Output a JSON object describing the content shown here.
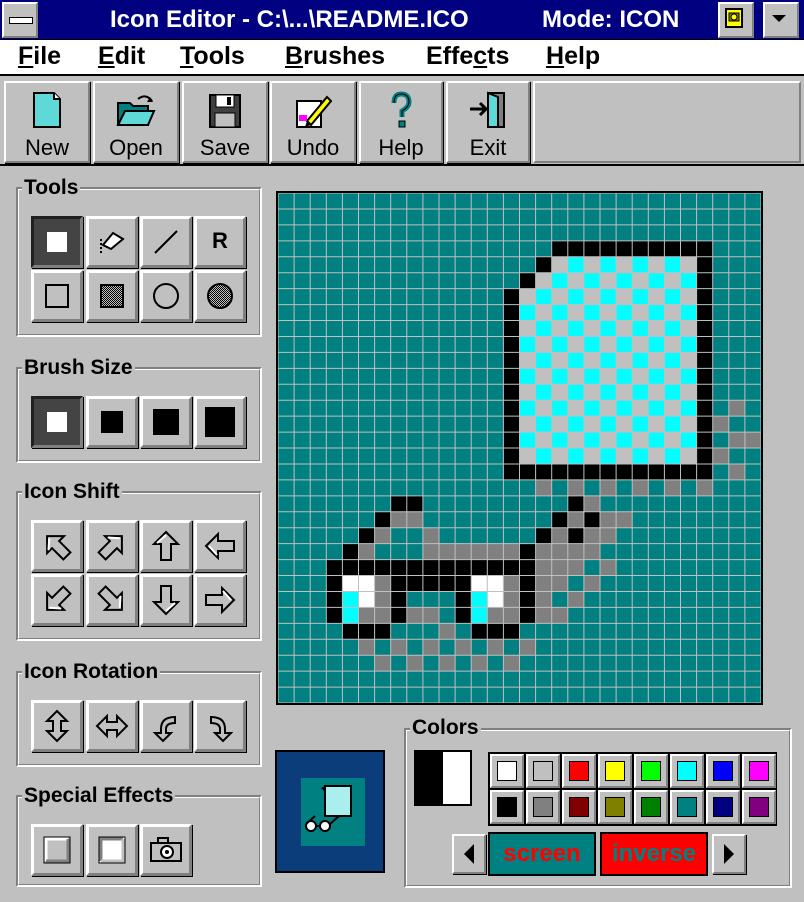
{
  "window": {
    "title": "Icon Editor - C:\\...\\README.ICO",
    "mode": "Mode: ICON"
  },
  "menu": [
    {
      "label": "File",
      "key": "F",
      "rest": "ile"
    },
    {
      "label": "Edit",
      "key": "E",
      "rest": "dit"
    },
    {
      "label": "Tools",
      "key": "T",
      "rest": "ools"
    },
    {
      "label": "Brushes",
      "key": "B",
      "rest": "rushes"
    },
    {
      "label": "Effects",
      "pre": "Effe",
      "key": "c",
      "rest": "ts"
    },
    {
      "label": "Help",
      "key": "H",
      "rest": "elp"
    }
  ],
  "toolbar": [
    {
      "label": "New",
      "icon": "new-document-icon"
    },
    {
      "label": "Open",
      "icon": "open-folder-icon"
    },
    {
      "label": "Save",
      "icon": "floppy-disk-icon"
    },
    {
      "label": "Undo",
      "icon": "undo-pencil-icon"
    },
    {
      "label": "Help",
      "icon": "question-mark-icon"
    },
    {
      "label": "Exit",
      "icon": "exit-door-icon"
    }
  ],
  "groups": {
    "tools": "Tools",
    "brush_size": "Brush Size",
    "icon_shift": "Icon Shift",
    "icon_rotation": "Icon Rotation",
    "special_effects": "Special Effects",
    "colors": "Colors"
  },
  "tools_r_label": "R",
  "palette": {
    "colors": [
      "#ffffff",
      "#c0c0c0",
      "#ff0000",
      "#ffff00",
      "#00ff00",
      "#00ffff",
      "#0000ff",
      "#ff00ff",
      "#000000",
      "#808080",
      "#800000",
      "#808000",
      "#008000",
      "#008080",
      "#000080",
      "#800080"
    ],
    "left_color": "#000000",
    "right_color": "#ffffff",
    "screen_label": "screen",
    "inverse_label": "inverse"
  },
  "accent": {
    "titlebar": "#000080",
    "canvas_bg": "#008080",
    "grid_line": "#c0c0c0",
    "preview_bg": "#0b3d7a"
  }
}
